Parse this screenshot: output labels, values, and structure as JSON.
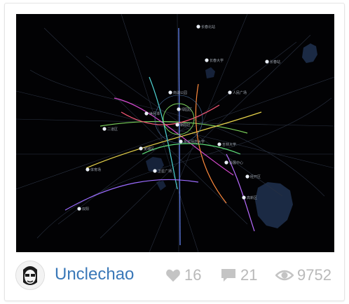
{
  "card": {
    "thumbnail": {
      "alt": "dark city transit map visualization",
      "map_labels": [
        "长春北站",
        "长春站",
        "长春大学",
        "人民广场",
        "南湖公园",
        "净月潭",
        "绿园区",
        "朝阳区",
        "二道区",
        "宽城区",
        "东北师范大学",
        "吉林大学",
        "会展中心",
        "体育场",
        "卫星广场",
        "经开区",
        "高新区",
        "双阳"
      ]
    },
    "author": {
      "name": "Unclechao",
      "avatar_icon": "cartoon-face-avatar"
    },
    "stats": {
      "likes": {
        "icon": "heart-icon",
        "count": "16"
      },
      "comments": {
        "icon": "comment-icon",
        "count": "21"
      },
      "views": {
        "icon": "eye-icon",
        "count": "9752"
      }
    }
  },
  "colors": {
    "author_link": "#3a78b8",
    "stat_text": "#b9b9b9",
    "map_bg": "#020204",
    "water": "#1b2a44"
  }
}
